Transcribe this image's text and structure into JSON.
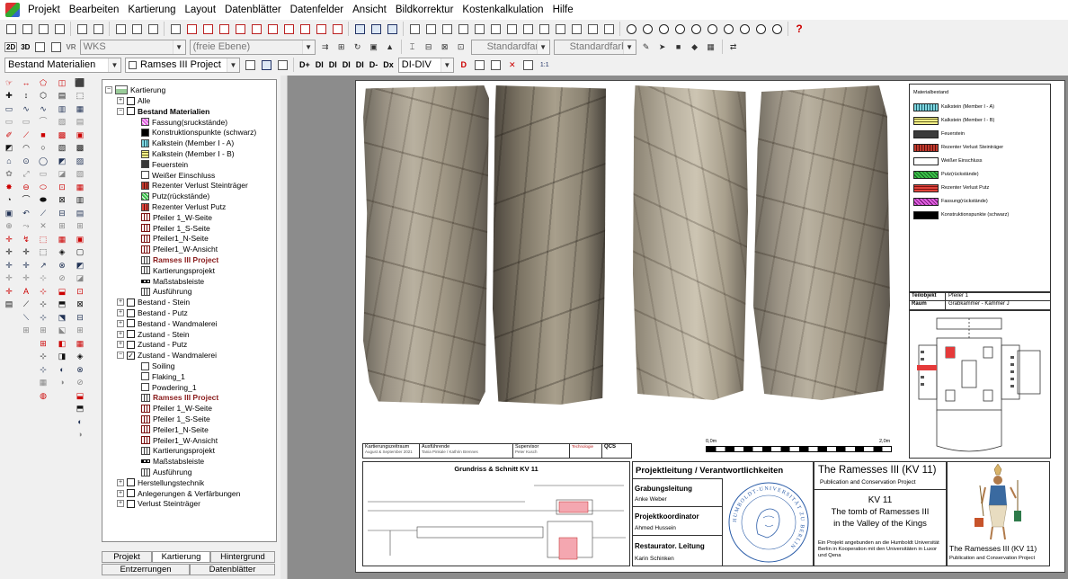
{
  "menu": [
    "Projekt",
    "Bearbeiten",
    "Kartierung",
    "Layout",
    "Datenblätter",
    "Datenfelder",
    "Ansicht",
    "Bildkorrektur",
    "Kostenkalkulation",
    "Hilfe"
  ],
  "toolbar2": {
    "mode_2d": "2D",
    "mode_3d": "3D",
    "vr": "VR",
    "coord_combo": "WKS",
    "plane_combo": "(freie Ebene)",
    "color1": "Standardfarbe",
    "color2": "Standardfarbe"
  },
  "toolbar3": {
    "layer_combo": "Bestand Materialien",
    "project_combo": "Ramses III Project",
    "buttons": [
      "D+",
      "DI",
      "DI",
      "DI",
      "DI",
      "D-",
      "Dx"
    ],
    "div_combo": "DI-DIV"
  },
  "tree": {
    "root": "Kartierung",
    "items": [
      {
        "label": "Alle",
        "level": 1,
        "exp": "+",
        "cb": "",
        "kind": "none"
      },
      {
        "label": "Bestand Materialien",
        "level": 1,
        "exp": "-",
        "cb": "",
        "kind": "none",
        "bold": true
      },
      {
        "label": "Fassung(sruckstände)",
        "level": 2,
        "cb": "",
        "kind": "swatch",
        "color": "#e060e0",
        "x": true
      },
      {
        "label": "Konstruktionspunkte (schwarz)",
        "level": 2,
        "cb": "",
        "kind": "swatch",
        "color": "#000000"
      },
      {
        "label": "Kalkstein (Member I - A)",
        "level": 2,
        "cb": "",
        "kind": "swatch",
        "color": "#7fd6e0"
      },
      {
        "label": "Kalkstein (Member I - B)",
        "level": 2,
        "cb": "",
        "kind": "swatch",
        "color": "#f2ee88"
      },
      {
        "label": "Feuerstein",
        "level": 2,
        "cb": "",
        "kind": "swatch",
        "color": "#3a3a3a"
      },
      {
        "label": "Weißer Einschluss",
        "level": 2,
        "cb": "",
        "kind": "swatch",
        "color": "#ffffff"
      },
      {
        "label": "Rezenter Verlust Steinträger",
        "level": 2,
        "cb": "",
        "kind": "swatch",
        "color": "#c0392b"
      },
      {
        "label": "Putz(rückstände)",
        "level": 2,
        "cb": "",
        "kind": "swatch",
        "color": "#3cbf4a"
      },
      {
        "label": "Rezenter Verlust Putz",
        "level": 2,
        "cb": "",
        "kind": "swatch",
        "color": "#e0433a"
      },
      {
        "label": "Pfeiler 1_W-Seite",
        "level": 2,
        "cb": "",
        "kind": "grid-red"
      },
      {
        "label": "Pfeiler 1_S-Seite",
        "level": 2,
        "cb": "",
        "kind": "grid-red"
      },
      {
        "label": "Pfeiler1_N-Seite",
        "level": 2,
        "cb": "",
        "kind": "grid-red"
      },
      {
        "label": "Pfeiler1_W-Ansicht",
        "level": 2,
        "cb": "",
        "kind": "grid-red"
      },
      {
        "label": "Ramses III Project",
        "level": 2,
        "cb": "",
        "kind": "grid",
        "red": true
      },
      {
        "label": "Kartierungsprojekt",
        "level": 2,
        "cb": "",
        "kind": "grid"
      },
      {
        "label": "Maßstabsleiste",
        "level": 2,
        "cb": "",
        "kind": "scale"
      },
      {
        "label": "Ausführung",
        "level": 2,
        "cb": "",
        "kind": "grid"
      },
      {
        "label": "Bestand - Stein",
        "level": 1,
        "exp": "+",
        "cb": "",
        "kind": "none"
      },
      {
        "label": "Bestand - Putz",
        "level": 1,
        "exp": "+",
        "cb": "",
        "kind": "none"
      },
      {
        "label": "Bestand - Wandmalerei",
        "level": 1,
        "exp": "+",
        "cb": "",
        "kind": "none"
      },
      {
        "label": "Zustand - Stein",
        "level": 1,
        "exp": "+",
        "cb": "",
        "kind": "none"
      },
      {
        "label": "Zustand - Putz",
        "level": 1,
        "exp": "+",
        "cb": "",
        "kind": "none"
      },
      {
        "label": "Zustand - Wandmalerei",
        "level": 1,
        "exp": "-",
        "cb": "✓",
        "kind": "none"
      },
      {
        "label": "Soiling",
        "level": 2,
        "cb": "",
        "kind": "swatch",
        "color": "#ffffff"
      },
      {
        "label": "Flaking_1",
        "level": 2,
        "cb": "",
        "kind": "swatch",
        "color": "#ffffff"
      },
      {
        "label": "Powdering_1",
        "level": 2,
        "cb": "",
        "kind": "swatch",
        "color": "#ffffff"
      },
      {
        "label": "Ramses III Project",
        "level": 2,
        "cb": "",
        "kind": "grid",
        "red": true
      },
      {
        "label": "Pfeiler 1_W-Seite",
        "level": 2,
        "cb": "",
        "kind": "grid-red"
      },
      {
        "label": "Pfeiler 1_S-Seite",
        "level": 2,
        "cb": "",
        "kind": "grid-red"
      },
      {
        "label": "Pfeiler1_N-Seite",
        "level": 2,
        "cb": "",
        "kind": "grid-red"
      },
      {
        "label": "Pfeiler1_W-Ansicht",
        "level": 2,
        "cb": "",
        "kind": "grid-red"
      },
      {
        "label": "Kartierungsprojekt",
        "level": 2,
        "cb": "",
        "kind": "grid"
      },
      {
        "label": "Maßstabsleiste",
        "level": 2,
        "cb": "",
        "kind": "scale"
      },
      {
        "label": "Ausführung",
        "level": 2,
        "cb": "",
        "kind": "grid"
      },
      {
        "label": "Herstellungstechnik",
        "level": 1,
        "exp": "+",
        "cb": "",
        "kind": "none"
      },
      {
        "label": "Anlegerungen & Verfärbungen",
        "level": 1,
        "exp": "+",
        "cb": "",
        "kind": "none"
      },
      {
        "label": "Verlust Steinträger",
        "level": 1,
        "exp": "+",
        "cb": "",
        "kind": "none"
      }
    ]
  },
  "tabs": {
    "projekt": "Projekt",
    "kartierung": "Kartierung",
    "hintergrund": "Hintergrund",
    "entzerrungen": "Entzerrungen",
    "datenblaetter": "Datenblätter"
  },
  "legend": {
    "title": "Materialbestand",
    "items": [
      {
        "label": "Kalkstein (Member I - A)",
        "color": "#7fd6e0"
      },
      {
        "label": "Kalkstein (Member I - B)",
        "color": "#f2ee88"
      },
      {
        "label": "Feuerstein",
        "color": "#3a3a3a"
      },
      {
        "label": "Rezenter Verlust Steinträger",
        "color": "#c0392b"
      },
      {
        "label": "Weißer Einschluss",
        "color": "#ffffff"
      },
      {
        "label": "Putz(rückstände)",
        "color": "#3cbf4a"
      },
      {
        "label": "Rezenter Verlust Putz",
        "color": "#e0433a"
      },
      {
        "label": "Fassung(rückstände)",
        "color": "#e060e0"
      },
      {
        "label": "Konstruktionspunkte (schwarz)",
        "color": "#000000"
      }
    ]
  },
  "info": {
    "teilobjekt_label": "Teilobjekt",
    "teilobjekt_value": "Pfeiler 1",
    "raum_label": "Raum",
    "raum_value": "Grabkammer - Kammer J"
  },
  "stamp": {
    "kartierungszeitraum": "Kartierungszeitraum",
    "kz_value": "August & September 2021",
    "ausfuehrende": "Ausführende",
    "af_value": "Tania Pinkale / Kathrin Brennes",
    "supervisor": "Supervisor",
    "sv_value": "Peter Kusch",
    "technology": "Technologie",
    "qcs": "QCS"
  },
  "scalebar": {
    "start": "0,0m",
    "end": "2,0m"
  },
  "titleblock": {
    "plan_title": "Grundriss & Schnitt KV 11",
    "lead_header": "Projektleitung / Verantwortlichkeiten",
    "grabung_label": "Grabungsleitung",
    "grabung_name": "Anke Weber",
    "koordinator_label": "Projektkoordinator",
    "koordinator_name": "Ahmed Hussein",
    "restaurator_label": "Restaurator. Leitung",
    "restaurator_name": "Karin Schinken",
    "seal_text": "HUMBOLDT-UNIVERSITÄT ZU BERLIN",
    "project_title": "The Ramesses III (KV 11)",
    "project_subtitle": "Publication and Conservation Project",
    "kv": "KV 11",
    "tomb_line1": "The tomb of Ramesses III",
    "tomb_line2": "in the Valley of the Kings",
    "footer_text": "Ein Projekt angebunden an die Humboldt Universität Berlin in Kooperation mit den Universitäten in Luxor und Qena",
    "logo_title": "The Ramesses III (KV 11)",
    "logo_subtitle": "Publication and Conservation Project"
  }
}
